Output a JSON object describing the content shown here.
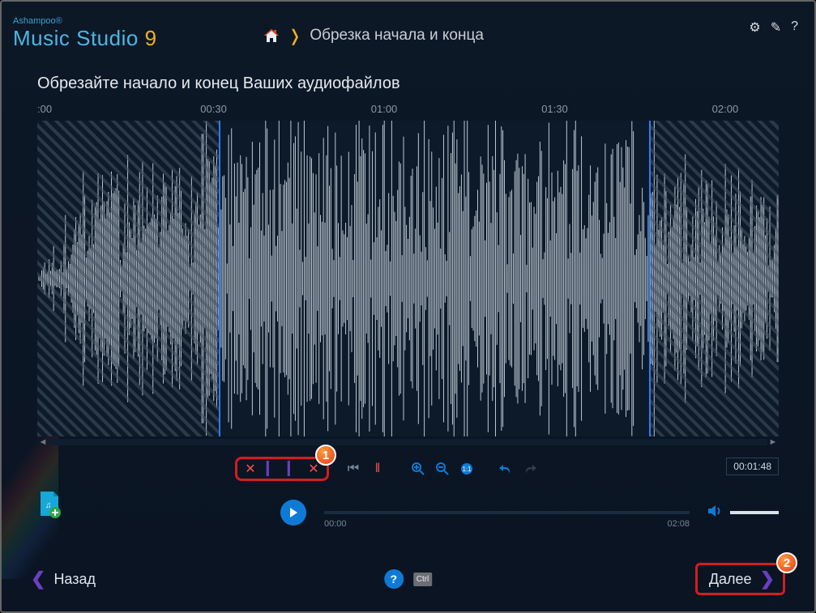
{
  "logo": {
    "brand_top": "Ashampoo®",
    "brand_main": "Music Studio ",
    "version": "9"
  },
  "breadcrumb": {
    "title": "Обрезка начала и конца"
  },
  "subtitle": "Обрезайте начало и конец Ваших аудиофайлов",
  "ruler": {
    "labels": [
      {
        "text": ":00",
        "pct": 0
      },
      {
        "text": "00:30",
        "pct": 22
      },
      {
        "text": "01:00",
        "pct": 45
      },
      {
        "text": "01:30",
        "pct": 68
      },
      {
        "text": "02:00",
        "pct": 91
      }
    ]
  },
  "trim": {
    "start_pct": 24.5,
    "end_pct": 82.5
  },
  "position_time": "00:01:48",
  "playback": {
    "current": "00:00",
    "total": "02:08"
  },
  "nav": {
    "back": "Назад",
    "next": "Далее"
  },
  "callouts": {
    "one": "1",
    "two": "2"
  },
  "ctrl_label": "Ctrl",
  "help_q": "?"
}
